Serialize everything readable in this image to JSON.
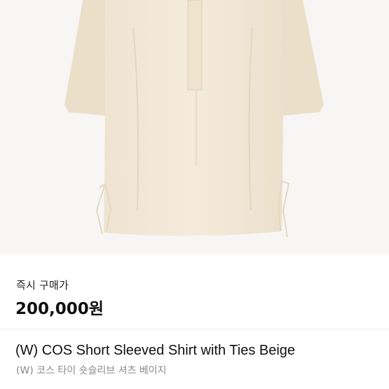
{
  "product": {
    "image_alt": "",
    "price_label": "즉시 구매가",
    "price": "200,000원",
    "title_en": "(W) COS Short Sleeved Shirt with Ties Beige",
    "title_ko": "(W) 코스 타이 숏슬리브 셔츠 베이지"
  },
  "colors": {
    "shirt": "#f1e7d6",
    "background": "#f7f6f4",
    "subtitle": "#8a8a8a"
  }
}
